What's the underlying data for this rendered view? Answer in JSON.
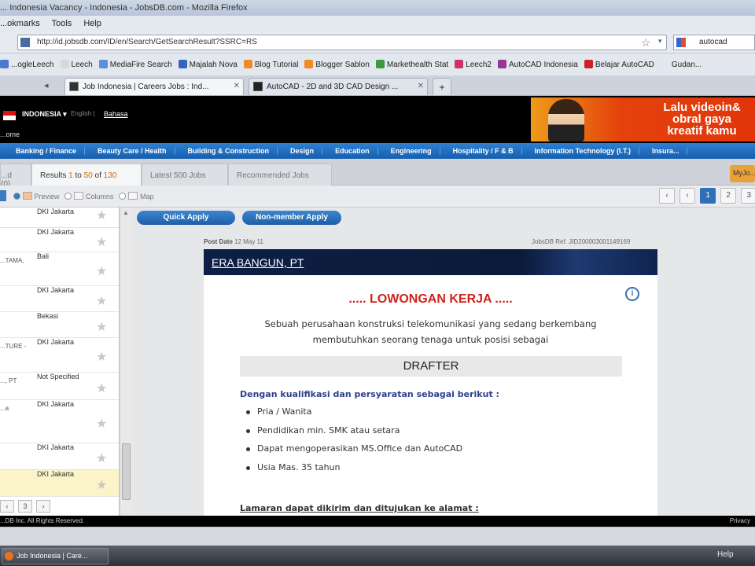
{
  "window": {
    "title": "... Indonesia Vacancy - Indonesia - JobsDB.com - Mozilla Firefox"
  },
  "menu": [
    "...okmarks",
    "Tools",
    "Help"
  ],
  "navbar": {
    "url": "http://id.jobsdb.com/ID/en/Search/GetSearchResult?SSRC=RS",
    "search_text": "autocad"
  },
  "bookmarks": [
    {
      "label": "...ogleLeech",
      "color": "#4a7acc"
    },
    {
      "label": "Leech",
      "color": "#d8d8d8"
    },
    {
      "label": "MediaFire Search",
      "color": "#5b8fd9"
    },
    {
      "label": "Majalah Nova",
      "color": "#3366bb"
    },
    {
      "label": "Blog Tutorial",
      "color": "#f08a24"
    },
    {
      "label": "Blogger Sablon",
      "color": "#f08a24"
    },
    {
      "label": "Markethealth Stat",
      "color": "#3c9a3c"
    },
    {
      "label": "Leech2",
      "color": "#cc3366"
    },
    {
      "label": "AutoCAD Indonesia",
      "color": "#993399"
    },
    {
      "label": "Belajar AutoCAD",
      "color": "#cc2222"
    },
    {
      "label": "Gudan...",
      "color": "#e3e7ee"
    }
  ],
  "tabs": [
    {
      "label": "Job Indonesia | Careers Jobs : Ind...",
      "active": true
    },
    {
      "label": "AutoCAD - 2D and 3D CAD Design ...",
      "active": false
    }
  ],
  "site": {
    "country": "INDONESIA ▾",
    "lang": "English |",
    "bahasa": "Bahasa",
    "home": "...ome"
  },
  "ad": {
    "text": "Lalu videoin&\nobral gaya\nkreatif kamu"
  },
  "categories": [
    "Banking / Finance",
    "Beauty Care / Health",
    "Building & Construction",
    "Design",
    "Education",
    "Engineering",
    "Hospitality / F & B",
    "Information Technology (I.T.)",
    "Insura..."
  ],
  "results_tabs": {
    "saved": "...d (0)",
    "results_prefix": "Results",
    "results_from": "1",
    "results_to_word": "to",
    "results_to": "50",
    "results_of_word": "of",
    "results_total": "130",
    "latest": "Latest 500 Jobs",
    "recommended": "Recommended Jobs"
  },
  "myjobs": "MyJo...",
  "view_options": {
    "preview": "Preview",
    "columns": "Columns",
    "map": "Map"
  },
  "pager": {
    "prev_first": "‹",
    "prev": "‹",
    "pages": [
      "1",
      "2",
      "3"
    ],
    "next": "›"
  },
  "left_list": [
    {
      "frag": "",
      "location": "DKI Jakarta"
    },
    {
      "frag": "",
      "location": "DKI Jakarta"
    },
    {
      "frag": "...TAMA,",
      "location": "Bali"
    },
    {
      "frag": "",
      "location": "DKI Jakarta"
    },
    {
      "frag": "",
      "location": "Bekasi"
    },
    {
      "frag": "...TURE -",
      "location": "DKI Jakarta"
    },
    {
      "frag": "..., PT",
      "location": "Not Specified"
    },
    {
      "frag": "...a",
      "location": "DKI Jakarta"
    },
    {
      "frag": "",
      "location": "DKI Jakarta"
    },
    {
      "frag": "",
      "location": "DKI Jakarta"
    }
  ],
  "left_pager": [
    "‹",
    "3",
    "›"
  ],
  "buttons": {
    "quick_apply": "Quick Apply",
    "nonmember_apply": "Non-member Apply"
  },
  "job": {
    "post_date_label": "Post Date",
    "post_date": "12 May 11",
    "ref": "JobsDB Ref. JID200003001149169",
    "company": "ERA BANGUN, PT",
    "heading": "..... LOWONGAN KERJA .....",
    "intro": "Sebuah perusahaan konstruksi telekomunikasi yang sedang berkembang membutuhkan seorang tenaga untuk posisi sebagai",
    "position": "DRAFTER",
    "qual_heading": "Dengan kualifikasi dan persyaratan sebagai berikut :",
    "qualifications": [
      "Pria / Wanita",
      "Pendidikan min. SMK atau setara",
      "Dapat mengoperasikan MS.Office dan AutoCAD",
      "Usia Mas. 35 tahun"
    ],
    "apply_heading": "Lamaran dapat dikirim dan ditujukan ke alamat :"
  },
  "footer": {
    "copyright": "...DB Inc. All Rights Reserved.",
    "privacy": "Privacy"
  },
  "taskbar": {
    "item": "Job Indonesia | Care...",
    "help": "Help"
  }
}
